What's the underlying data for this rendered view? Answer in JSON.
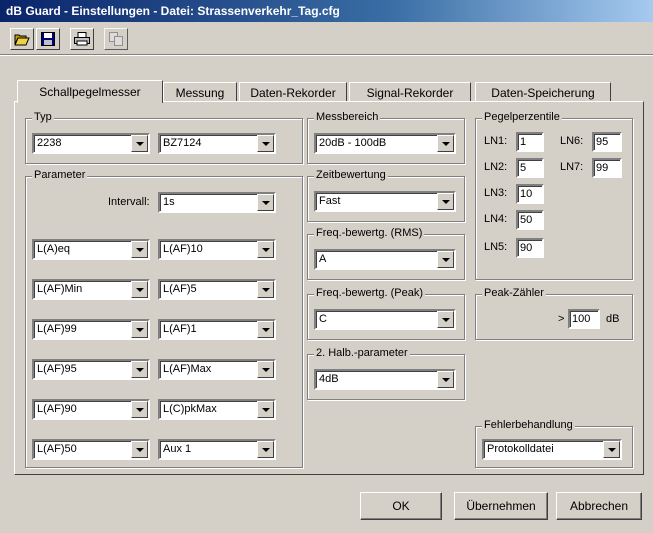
{
  "window": {
    "title": "dB Guard  -  Einstellungen  -  Datei: Strassenverkehr_Tag.cfg"
  },
  "toolbar": {
    "buttons": [
      {
        "name": "open",
        "icon": "open-folder-icon"
      },
      {
        "name": "save",
        "icon": "save-disk-icon"
      },
      {
        "name": "print",
        "icon": "printer-icon"
      },
      {
        "name": "copy",
        "icon": "copy-icon"
      }
    ]
  },
  "tabs": [
    {
      "label": "Schallpegelmesser",
      "active": true
    },
    {
      "label": "Messung"
    },
    {
      "label": "Daten-Rekorder"
    },
    {
      "label": "Signal-Rekorder"
    },
    {
      "label": "Daten-Speicherung"
    }
  ],
  "typ": {
    "legend": "Typ",
    "device": "2238",
    "module": "BZ7124"
  },
  "parameter": {
    "legend": "Parameter",
    "intervall_label": "Intervall:",
    "intervall_value": "1s",
    "left": [
      "L(A)eq",
      "L(AF)Min",
      "L(AF)99",
      "L(AF)95",
      "L(AF)90",
      "L(AF)50"
    ],
    "right": [
      "L(AF)10",
      "L(AF)5",
      "L(AF)1",
      "L(AF)Max",
      "L(C)pkMax",
      "Aux 1"
    ]
  },
  "messbereich": {
    "legend": "Messbereich",
    "value": "20dB - 100dB"
  },
  "zeitbewertung": {
    "legend": "Zeitbewertung",
    "value": "Fast"
  },
  "freq_rms": {
    "legend": "Freq.-bewertg. (RMS)",
    "value": "A"
  },
  "freq_peak": {
    "legend": "Freq.-bewertg. (Peak)",
    "value": "C"
  },
  "halb": {
    "legend": "2. Halb.-parameter",
    "value": "4dB"
  },
  "pegelperzentile": {
    "legend": "Pegelperzentile",
    "items": [
      {
        "label": "LN1:",
        "value": "1"
      },
      {
        "label": "LN2:",
        "value": "5"
      },
      {
        "label": "LN3:",
        "value": "10"
      },
      {
        "label": "LN4:",
        "value": "50"
      },
      {
        "label": "LN5:",
        "value": "90"
      },
      {
        "label": "LN6:",
        "value": "95"
      },
      {
        "label": "LN7:",
        "value": "99"
      }
    ]
  },
  "peak_zaehler": {
    "legend": "Peak-Zähler",
    "prefix": ">",
    "value": "100",
    "unit": "dB"
  },
  "fehler": {
    "legend": "Fehlerbehandlung",
    "value": "Protokolldatei"
  },
  "buttons": {
    "ok": "OK",
    "apply": "Übernehmen",
    "cancel": "Abbrechen"
  }
}
